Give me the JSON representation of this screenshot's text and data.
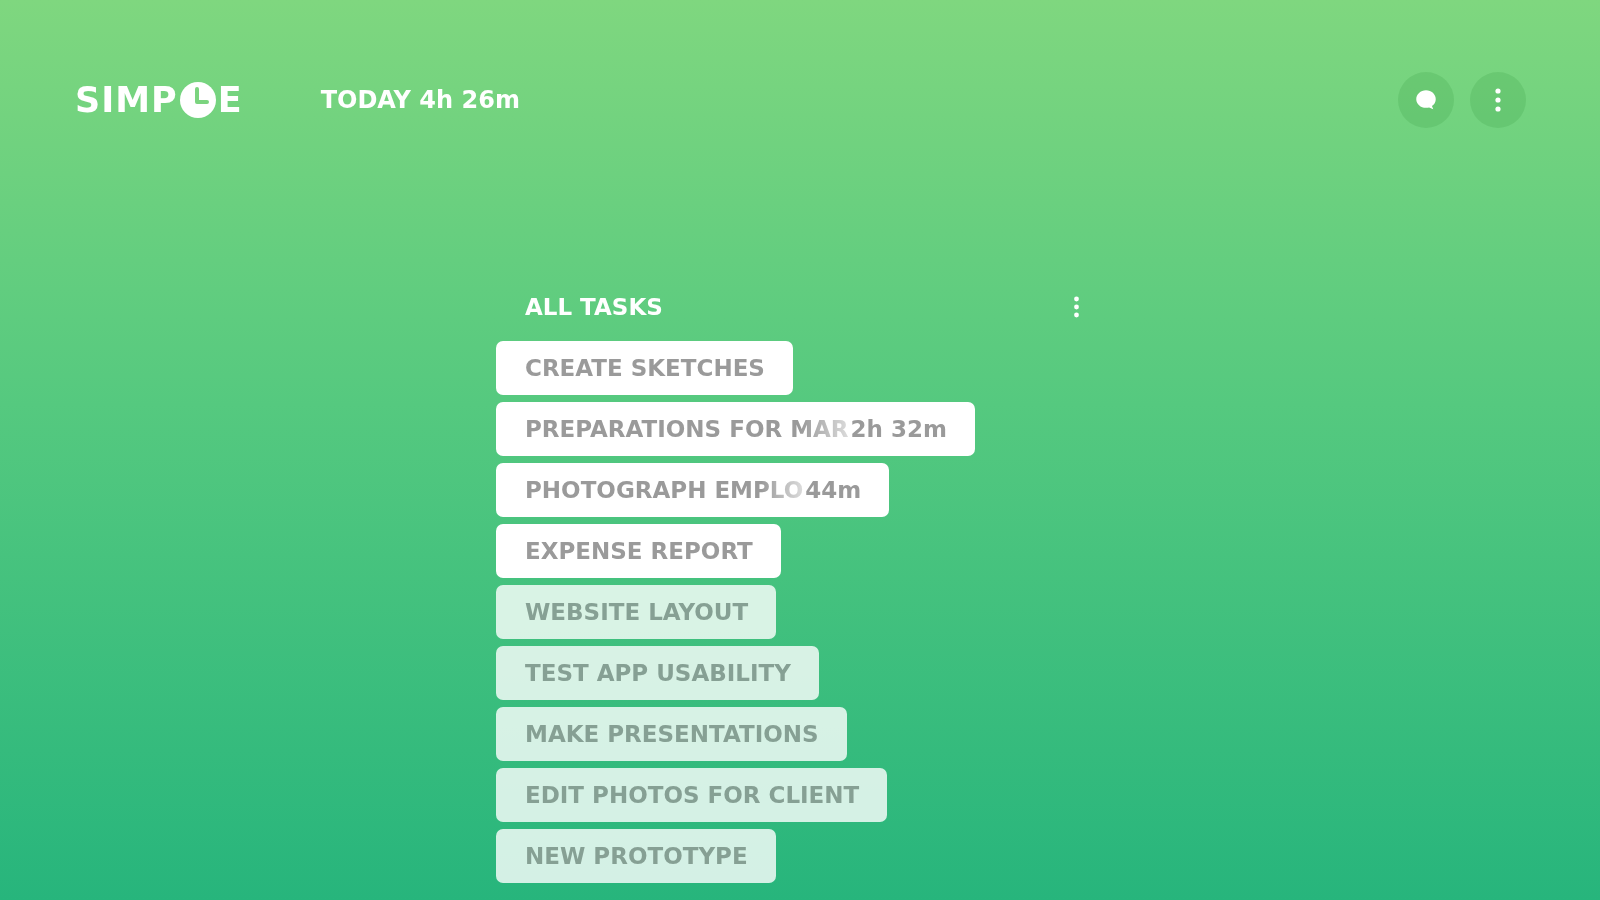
{
  "header": {
    "logo": {
      "before": "SIMP",
      "after": "E"
    },
    "today": "TODAY 4h 26m"
  },
  "list": {
    "title": "ALL TASKS",
    "tasks": [
      {
        "name": "CREATE SKETCHES",
        "faded": false
      },
      {
        "name": "PREPARATIONS FOR MAR",
        "time": "2h 32m",
        "faded": false
      },
      {
        "name": "PHOTOGRAPH EMPLO",
        "time": "44m",
        "faded": false
      },
      {
        "name": "EXPENSE REPORT",
        "faded": false
      },
      {
        "name": "WEBSITE LAYOUT",
        "faded": true
      },
      {
        "name": "TEST APP USABILITY",
        "faded": true
      },
      {
        "name": "MAKE PRESENTATIONS",
        "faded": true
      },
      {
        "name": "EDIT PHOTOS FOR CLIENT",
        "faded": true
      },
      {
        "name": "NEW PROTOTYPE",
        "faded": true
      }
    ]
  }
}
